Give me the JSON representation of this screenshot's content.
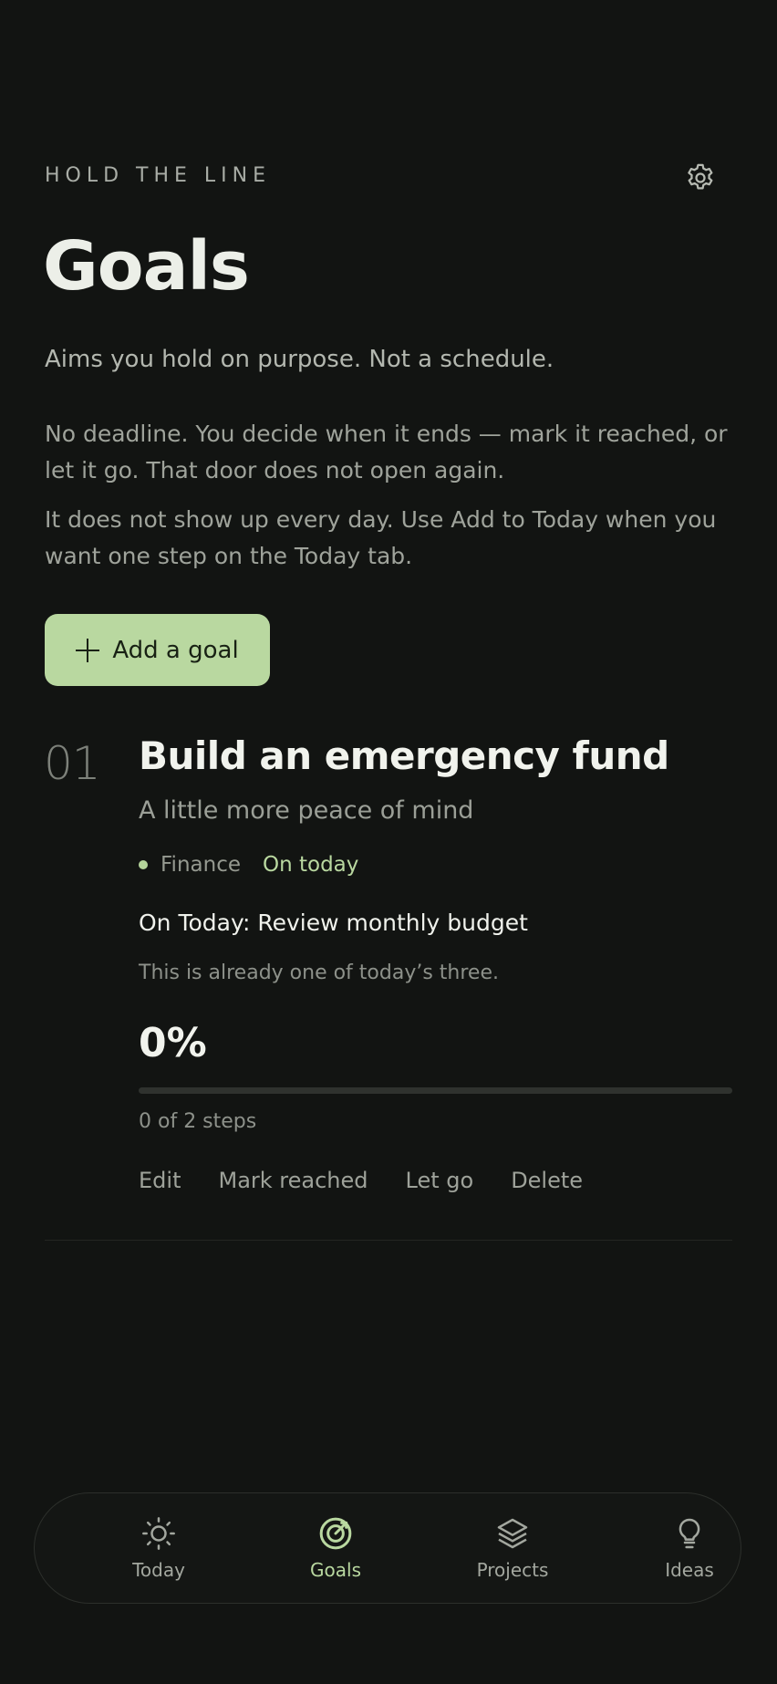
{
  "header": {
    "eyebrow": "HOLD THE LINE",
    "title": "Goals",
    "subtitle": "Aims you hold on purpose. Not a schedule.",
    "paragraph1": "No deadline. You decide when it ends — mark it reached, or let it go. That door does not open again.",
    "paragraph2": "It does not show up every day. Use Add to Today when you want one step on the Today tab.",
    "settings_icon": "gear-icon"
  },
  "add_goal": {
    "label": "Add a goal",
    "icon": "plus-icon"
  },
  "goals": [
    {
      "index": "01",
      "title": "Build an emergency fund",
      "tagline": "A little more peace of mind",
      "category": "Finance",
      "status": "On today",
      "on_today": "On Today: Review monthly budget",
      "note": "This is already one of today’s three.",
      "percent_label": "0%",
      "progress_fraction": 0,
      "steps": "0 of 2 steps",
      "actions": {
        "edit": "Edit",
        "mark_reached": "Mark reached",
        "let_go": "Let go",
        "delete": "Delete"
      }
    }
  ],
  "tabbar": {
    "active": "Goals",
    "tabs": [
      {
        "label": "Today",
        "icon": "sun-icon"
      },
      {
        "label": "Goals",
        "icon": "target-icon"
      },
      {
        "label": "Projects",
        "icon": "layers-icon"
      },
      {
        "label": "Ideas",
        "icon": "lightbulb-icon"
      }
    ]
  },
  "colors": {
    "background": "#121412",
    "accent": "#b9d8a0",
    "text": "#ecefe8",
    "muted": "#9fa39b"
  }
}
